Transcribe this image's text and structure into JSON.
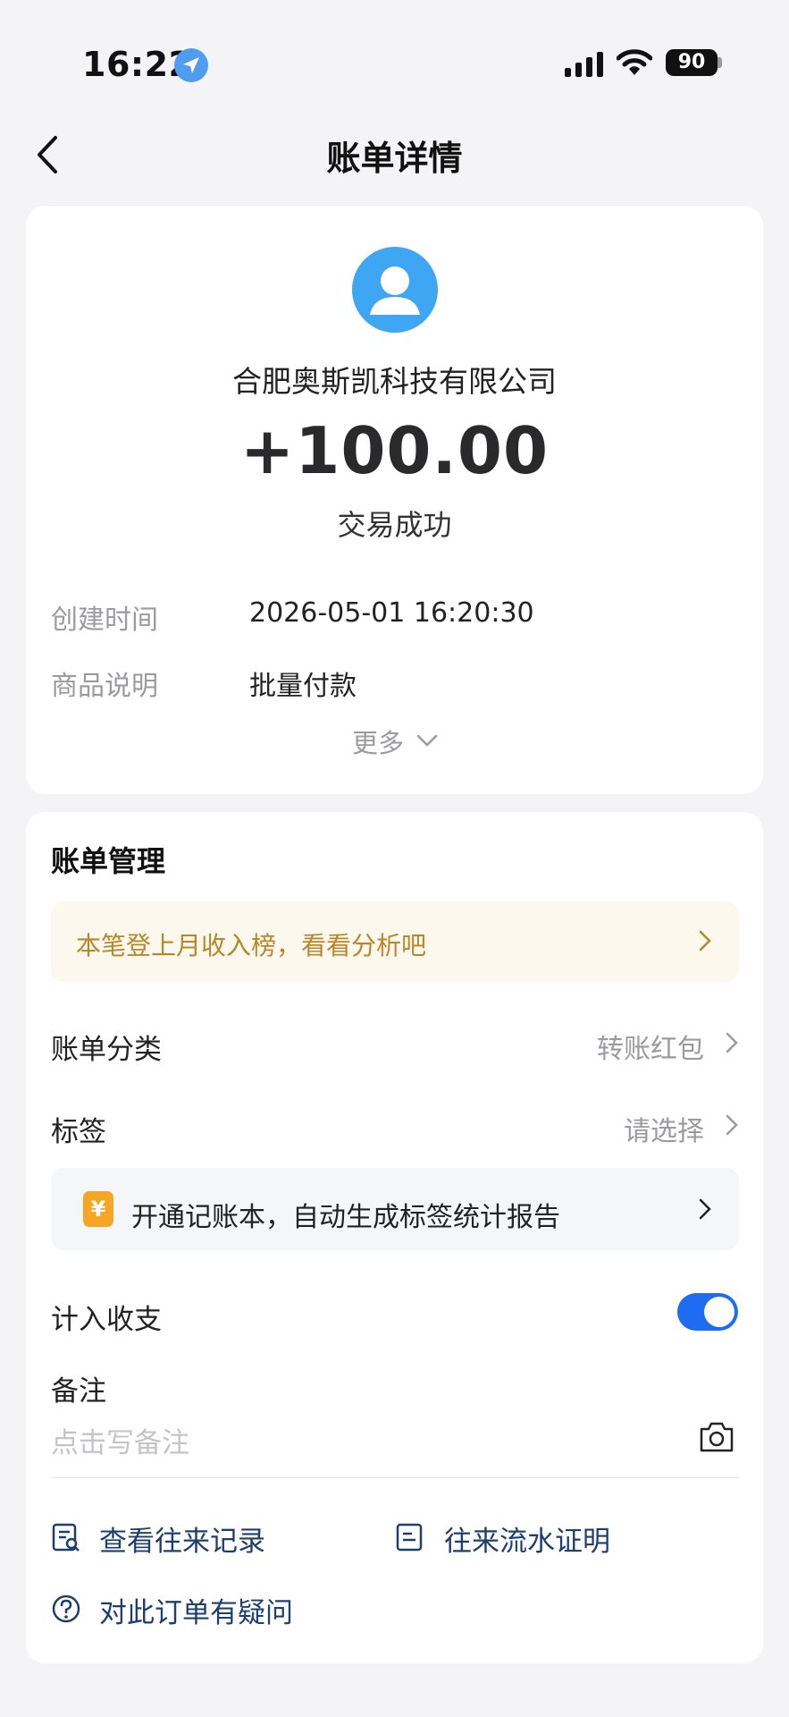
{
  "status_bar": {
    "time": "16:22",
    "battery": "90"
  },
  "nav": {
    "title": "账单详情"
  },
  "summary": {
    "company": "合肥奥斯凯科技有限公司",
    "amount": "+100.00",
    "status": "交易成功",
    "rows": [
      {
        "label": "创建时间",
        "value": "2026-05-01 16:20:30"
      },
      {
        "label": "商品说明",
        "value": "批量付款"
      }
    ],
    "more": "更多"
  },
  "management": {
    "title": "账单管理",
    "promo": "本笔登上月收入榜，看看分析吧",
    "category": {
      "label": "账单分类",
      "value": "转账红包"
    },
    "tag": {
      "label": "标签",
      "value": "请选择"
    },
    "ledger_banner": {
      "icon_text": "¥",
      "text": "开通记账本，自动生成标签统计报告"
    },
    "count_in": {
      "label": "计入收支",
      "enabled": true
    },
    "note": {
      "label": "备注",
      "placeholder": "点击写备注"
    },
    "actions": {
      "history": "查看往来记录",
      "proof": "往来流水证明",
      "question": "对此订单有疑问"
    }
  },
  "colors": {
    "accent": "#1e6cf2",
    "avatar": "#3ea6f2",
    "promo_text": "#b8872a",
    "coin": "#f5a623"
  }
}
